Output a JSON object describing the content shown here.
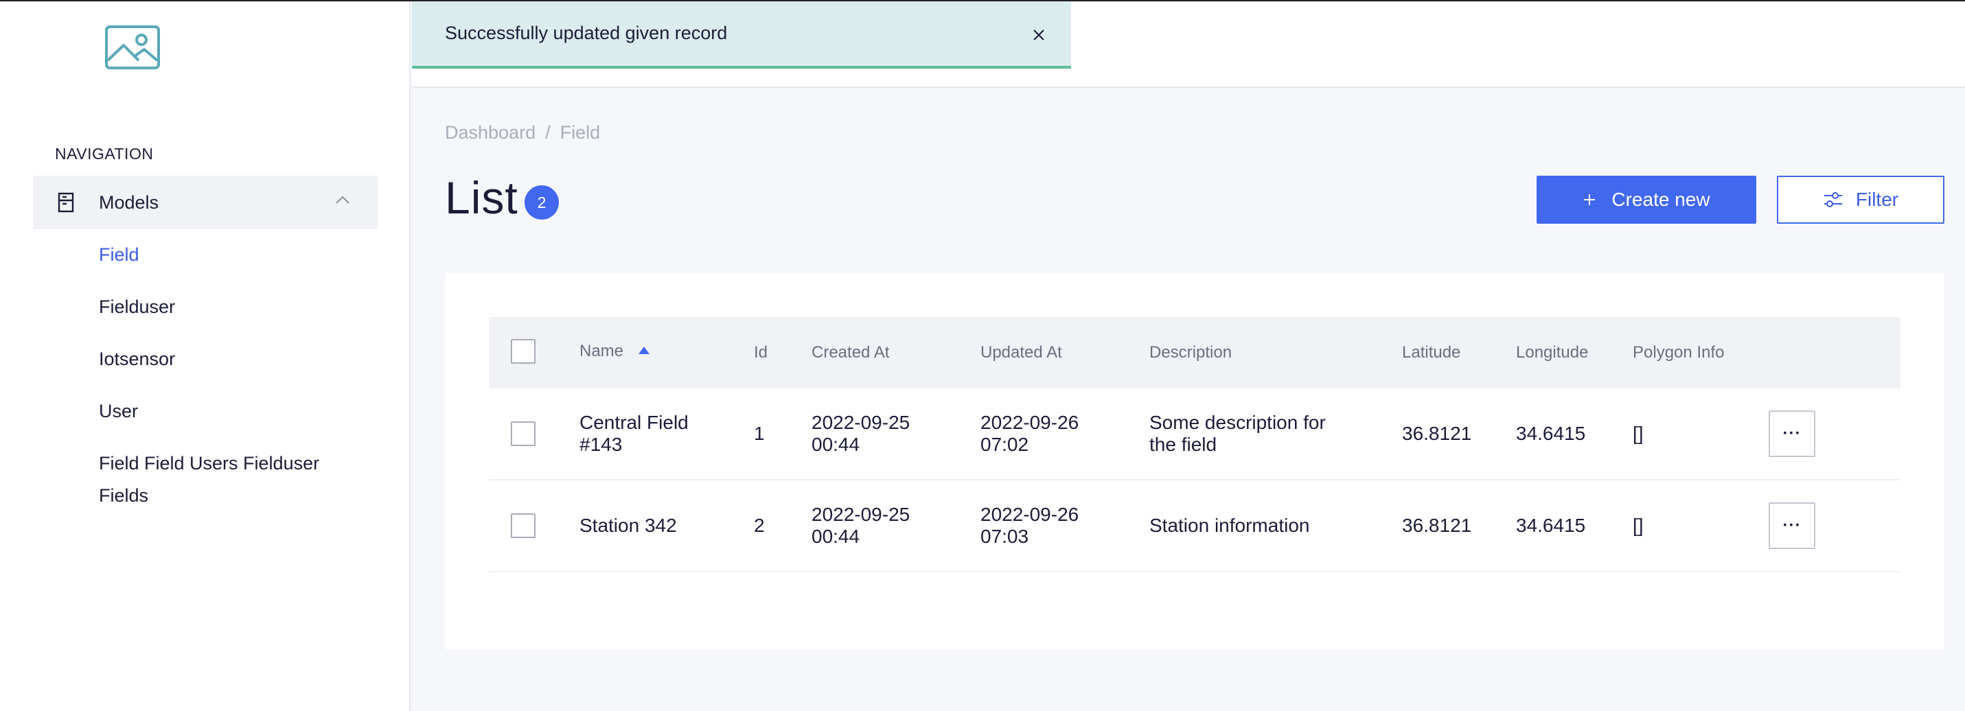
{
  "toast": {
    "message": "Successfully updated given record",
    "close_icon": "close-icon"
  },
  "sidebar": {
    "logo_icon": "image-placeholder-icon",
    "nav_title": "NAVIGATION",
    "group": {
      "label": "Models",
      "icon": "database-icon",
      "expanded": true
    },
    "items": [
      {
        "label": "Field",
        "active": true
      },
      {
        "label": "Fielduser",
        "active": false
      },
      {
        "label": "Iotsensor",
        "active": false
      },
      {
        "label": "User",
        "active": false
      },
      {
        "label": "Field Field Users Fielduser Fields",
        "active": false
      }
    ]
  },
  "breadcrumb": {
    "home": "Dashboard",
    "separator": "/",
    "current": "Field"
  },
  "page": {
    "title": "List",
    "count": "2"
  },
  "actions": {
    "create_label": "Create new",
    "filter_label": "Filter"
  },
  "table": {
    "columns": {
      "name": "Name",
      "id": "Id",
      "created_at": "Created At",
      "updated_at": "Updated At",
      "description": "Description",
      "latitude": "Latitude",
      "longitude": "Longitude",
      "polygon_info": "Polygon Info"
    },
    "sort": {
      "column": "Name",
      "direction": "ascending"
    },
    "rows": [
      {
        "name_line1": "Central Field",
        "name_line2": "#143",
        "id": "1",
        "created_date": "2022-09-25",
        "created_time": "00:44",
        "updated_date": "2022-09-26",
        "updated_time": "07:02",
        "desc_line1": "Some description for",
        "desc_line2": "the field",
        "latitude": "36.8121",
        "longitude": "34.6415",
        "polygon_info": "[]",
        "actions": "···"
      },
      {
        "name_line1": "Station 342",
        "name_line2": "",
        "id": "2",
        "created_date": "2022-09-25",
        "created_time": "00:44",
        "updated_date": "2022-09-26",
        "updated_time": "07:03",
        "desc_line1": "Station information",
        "desc_line2": "",
        "latitude": "36.8121",
        "longitude": "34.6415",
        "polygon_info": "[]",
        "actions": "···"
      }
    ]
  },
  "colors": {
    "primary": "#4268f0",
    "toast_bg": "#dbecee",
    "toast_border": "#5ebd9a",
    "page_bg": "#f6f7fb"
  }
}
